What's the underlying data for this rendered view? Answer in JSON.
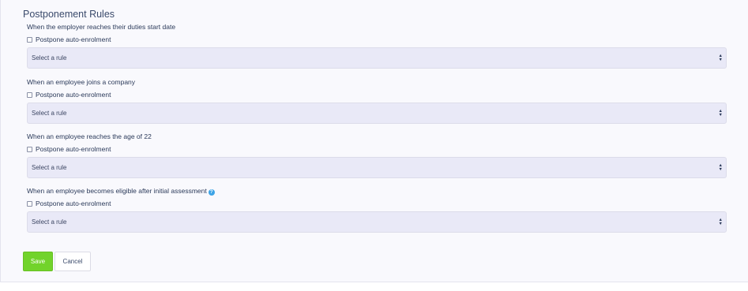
{
  "section": {
    "title": "Postponement Rules"
  },
  "rules": [
    {
      "heading": "When the employer reaches their duties start date",
      "checkbox_label": "Postpone auto-enrolment",
      "checked": false,
      "select_value": "Select a rule"
    },
    {
      "heading": "When an employee joins a company",
      "checkbox_label": "Postpone auto-enrolment",
      "checked": false,
      "select_value": "Select a rule"
    },
    {
      "heading": "When an employee reaches the age of 22",
      "checkbox_label": "Postpone auto-enrolment",
      "checked": false,
      "select_value": "Select a rule"
    },
    {
      "heading": "When an employee becomes eligible after initial assessment",
      "checkbox_label": "Postpone auto-enrolment",
      "checked": false,
      "select_value": "Select a rule",
      "help_icon": "question-circle-icon"
    }
  ],
  "actions": {
    "save_label": "Save",
    "cancel_label": "Cancel"
  },
  "colors": {
    "save_button": "#72d32b",
    "select_background": "#e9e9f7",
    "help_icon": "#3ea4e6"
  },
  "icons": {
    "select_arrows": "sort-arrows-icon",
    "help": "question-circle-icon"
  }
}
